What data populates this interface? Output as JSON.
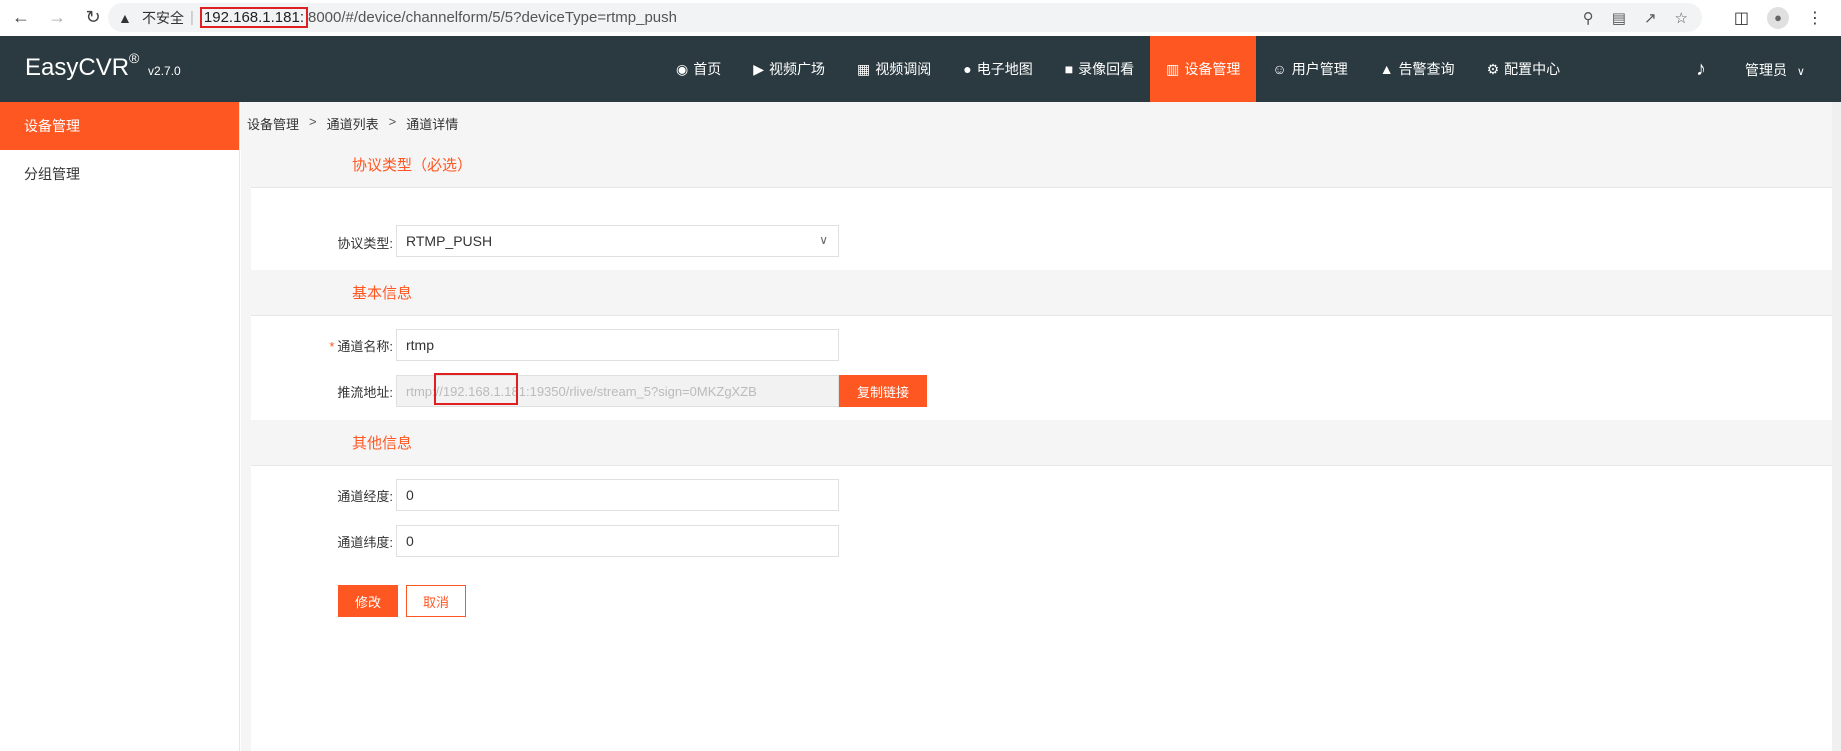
{
  "browser": {
    "insecure_label": "不安全",
    "url_host": "192.168.1.181:",
    "url_rest": "8000/#/device/channelform/5/5?deviceType=rtmp_push"
  },
  "app": {
    "logo": "EasyCVR",
    "logo_mark": "®",
    "version": "v2.7.0",
    "admin": "管理员"
  },
  "nav": [
    {
      "label": "首页",
      "icon": "dashboard-icon"
    },
    {
      "label": "视频广场",
      "icon": "play-icon"
    },
    {
      "label": "视频调阅",
      "icon": "grid-icon"
    },
    {
      "label": "电子地图",
      "icon": "map-pin-icon"
    },
    {
      "label": "录像回看",
      "icon": "video-camera-icon"
    },
    {
      "label": "设备管理",
      "icon": "device-icon",
      "active": true
    },
    {
      "label": "用户管理",
      "icon": "user-icon"
    },
    {
      "label": "告警查询",
      "icon": "alarm-icon"
    },
    {
      "label": "配置中心",
      "icon": "gear-icon"
    }
  ],
  "sidebar": {
    "items": [
      {
        "label": "设备管理",
        "active": true
      },
      {
        "label": "分组管理"
      }
    ]
  },
  "breadcrumb": [
    "设备管理",
    "通道列表",
    "通道详情"
  ],
  "breadcrumb_sep": ">",
  "sections": {
    "protocol": "协议类型（必选）",
    "basic": "基本信息",
    "other": "其他信息"
  },
  "form": {
    "protocol_label": "协议类型:",
    "protocol_value": "RTMP_PUSH",
    "required_mark": "*",
    "name_label": "通道名称:",
    "name_value": "rtmp",
    "push_label": "推流地址:",
    "push_value": "rtmp://192.168.1.181:19350/rlive/stream_5?sign=0MKZgXZB",
    "copy_button": "复制链接",
    "longitude_label": "通道经度:",
    "longitude_value": "0",
    "latitude_label": "通道纬度:",
    "latitude_value": "0",
    "submit_button": "修改",
    "cancel_button": "取消"
  },
  "colors": {
    "accent": "#ff5722",
    "header": "#2b3a40",
    "highlight": "#e02020"
  }
}
